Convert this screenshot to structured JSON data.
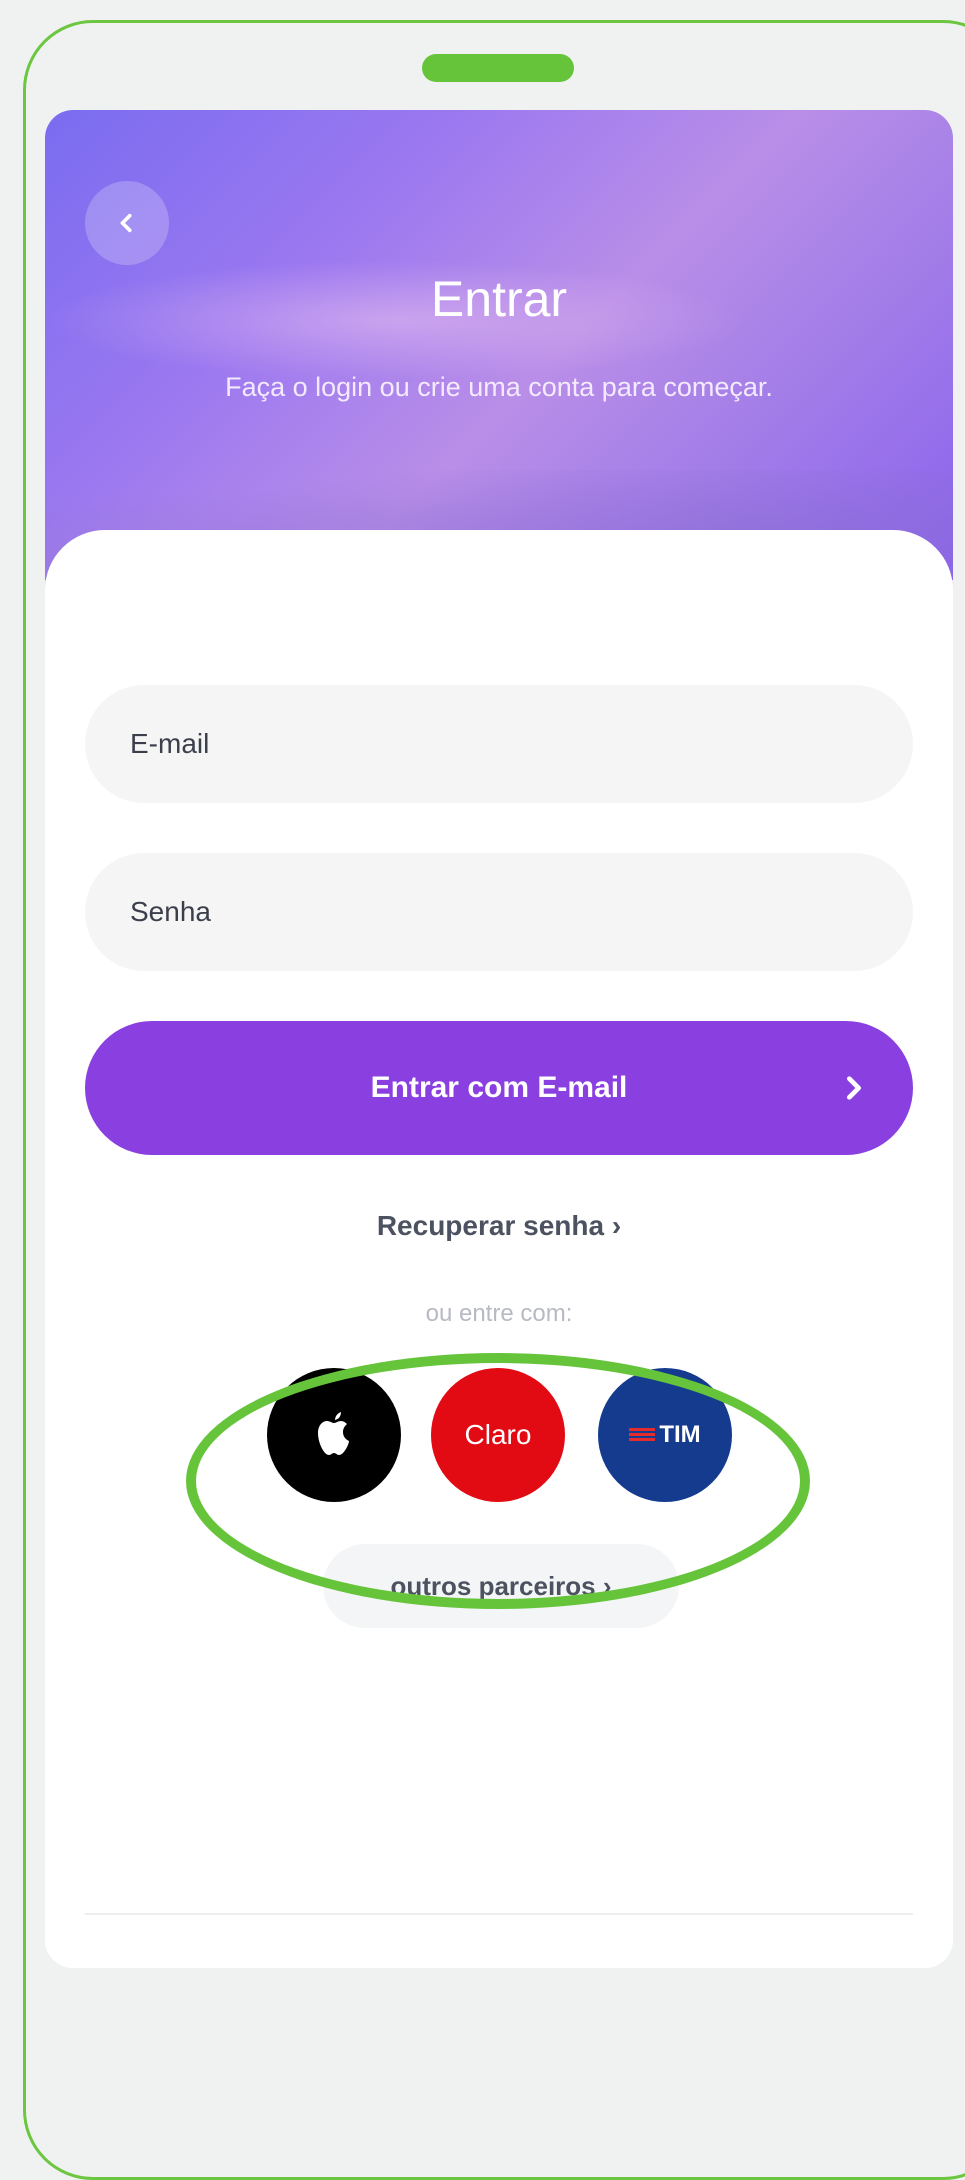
{
  "header": {
    "title": "Entrar",
    "subtitle": "Faça o login ou crie uma conta para começar."
  },
  "form": {
    "email_placeholder": "E-mail",
    "password_placeholder": "Senha",
    "submit_label": "Entrar com E-mail"
  },
  "links": {
    "recover": "Recuperar senha ›",
    "or_label": "ou entre com:",
    "other_partners": "outros parceiros ›"
  },
  "partners": {
    "apple_icon": "apple-logo",
    "claro_label": "Claro",
    "tim_label": "TIM"
  },
  "colors": {
    "accent": "#8a3fe0",
    "highlight": "#66c43b",
    "claro": "#e20a13",
    "tim": "#143b8e"
  }
}
